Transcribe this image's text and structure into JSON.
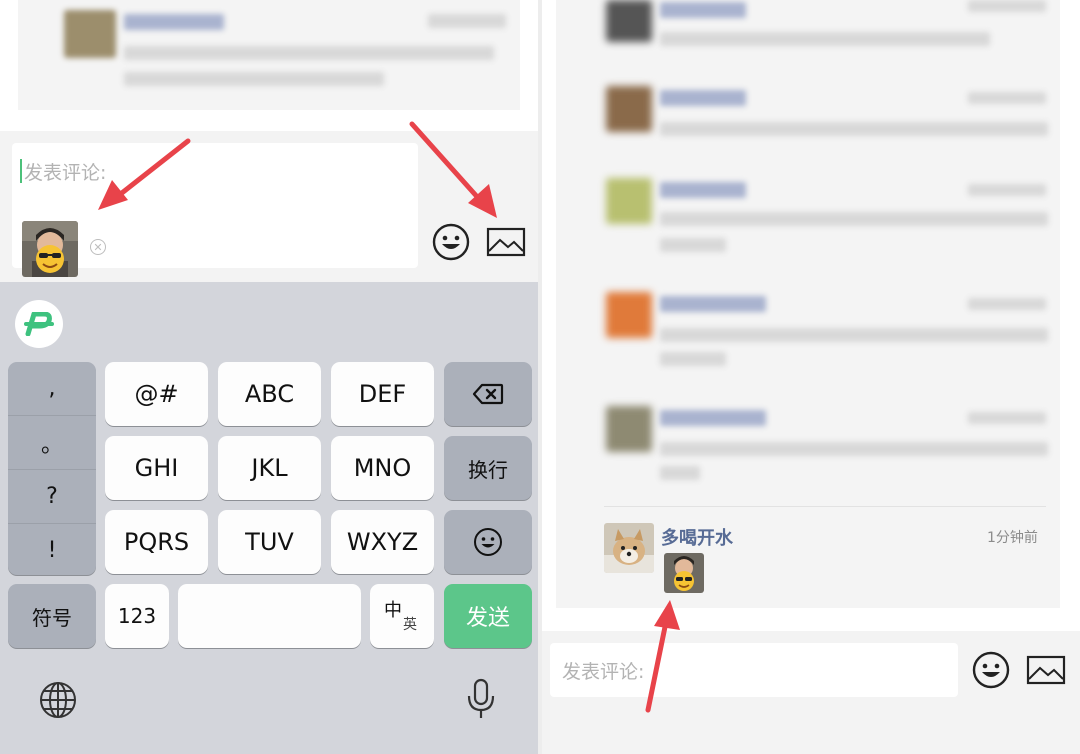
{
  "left": {
    "composer": {
      "placeholder": "发表评论:"
    },
    "keyboard": {
      "punctuation": [
        ",",
        "。",
        "?",
        "!"
      ],
      "row1": [
        "@#",
        "ABC",
        "DEF"
      ],
      "row2": [
        "GHI",
        "JKL",
        "MNO"
      ],
      "row3": [
        "PQRS",
        "TUV",
        "WXYZ"
      ],
      "newline_label": "换行",
      "symbols_label": "符号",
      "numbers_label": "123",
      "lang_toggle_top": "中",
      "lang_toggle_bottom": "英",
      "send_label": "发送"
    }
  },
  "right": {
    "new_comment": {
      "author": "多喝开水",
      "time": "1分钟前"
    },
    "composer": {
      "placeholder": "发表评论:"
    }
  },
  "colors": {
    "arrow": "#e8434a",
    "send_button": "#5cc68a",
    "author_name": "#576b95",
    "cursor": "#4cc17a"
  }
}
